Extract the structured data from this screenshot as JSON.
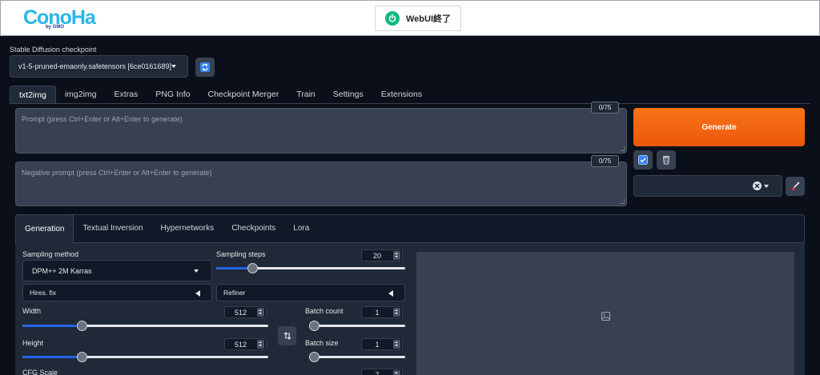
{
  "header": {
    "logo_text": "ConoHa",
    "logo_sub": "by GMO",
    "end_button": "WebUI終了"
  },
  "checkpoint": {
    "label": "Stable Diffusion checkpoint",
    "value": "v1-5-pruned-emaonly.safetensors [6ce0161689]"
  },
  "tabs": [
    "txt2img",
    "img2img",
    "Extras",
    "PNG Info",
    "Checkpoint Merger",
    "Train",
    "Settings",
    "Extensions"
  ],
  "prompt": {
    "placeholder": "Prompt (press Ctrl+Enter or Alt+Enter to generate)",
    "tokens": "0/75"
  },
  "negative_prompt": {
    "placeholder": "Negative prompt (press Ctrl+Enter or Alt+Enter to generate)",
    "tokens": "0/75"
  },
  "generate_label": "Generate",
  "subtabs": [
    "Generation",
    "Textual Inversion",
    "Hypernetworks",
    "Checkpoints",
    "Lora"
  ],
  "sampling_method": {
    "label": "Sampling method",
    "value": "DPM++ 2M Karras"
  },
  "sampling_steps": {
    "label": "Sampling steps",
    "value": "20",
    "level": 0.19
  },
  "hires_fix": "Hires. fix",
  "refiner": "Refiner",
  "width": {
    "label": "Width",
    "value": "512",
    "level": 0.24
  },
  "height": {
    "label": "Height",
    "value": "512",
    "level": 0.24
  },
  "batch_count": {
    "label": "Batch count",
    "value": "1",
    "level": 0.0
  },
  "batch_size": {
    "label": "Batch size",
    "value": "1",
    "level": 0.0
  },
  "cfg_scale": {
    "label": "CFG Scale",
    "value": "7"
  },
  "colors": {
    "accent": "#f97316",
    "slider": "#2563eb",
    "background": "#0b0f19"
  }
}
